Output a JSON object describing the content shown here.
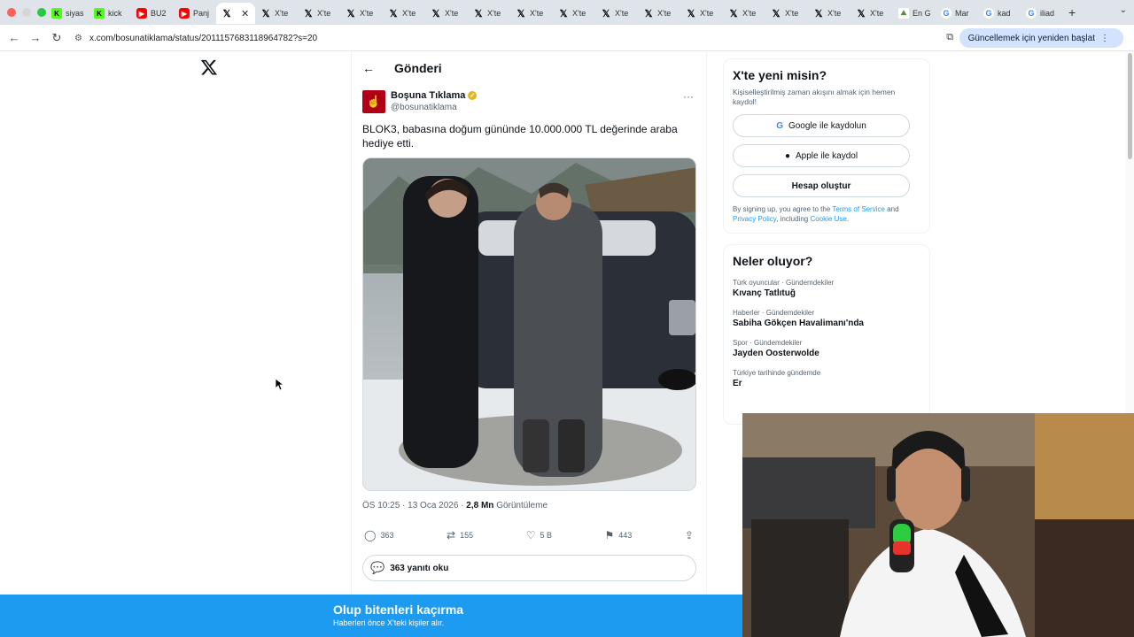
{
  "browser": {
    "tabs": [
      {
        "icon": "kick-icon",
        "label": "siyas"
      },
      {
        "icon": "kick-icon",
        "label": "kick"
      },
      {
        "icon": "youtube-icon",
        "label": "BU2"
      },
      {
        "icon": "youtube-icon",
        "label": "Panj"
      },
      {
        "icon": "x-icon",
        "label": "",
        "active": true
      },
      {
        "icon": "x-icon",
        "label": "X'te"
      },
      {
        "icon": "x-icon",
        "label": "X'te"
      },
      {
        "icon": "x-icon",
        "label": "X'te"
      },
      {
        "icon": "x-icon",
        "label": "X'te"
      },
      {
        "icon": "x-icon",
        "label": "X'te"
      },
      {
        "icon": "x-icon",
        "label": "X'te"
      },
      {
        "icon": "x-icon",
        "label": "X'te"
      },
      {
        "icon": "x-icon",
        "label": "X'te"
      },
      {
        "icon": "x-icon",
        "label": "X'te"
      },
      {
        "icon": "x-icon",
        "label": "X'te"
      },
      {
        "icon": "x-icon",
        "label": "X'te"
      },
      {
        "icon": "x-icon",
        "label": "X'te"
      },
      {
        "icon": "x-icon",
        "label": "X'te"
      },
      {
        "icon": "x-icon",
        "label": "X'te"
      },
      {
        "icon": "x-icon",
        "label": "X'te"
      },
      {
        "icon": "ensonhaber-icon",
        "label": "En G"
      },
      {
        "icon": "google-icon",
        "label": "Mar"
      },
      {
        "icon": "google-icon",
        "label": "kad"
      },
      {
        "icon": "google-icon",
        "label": "iliad"
      }
    ],
    "url": "x.com/bosunatiklama/status/2011157683118964782?s=20",
    "update_label": "Güncellemek için yeniden başlat"
  },
  "post": {
    "header_title": "Gönderi",
    "author_name": "Boşuna Tıklama",
    "author_handle": "@bosunatiklama",
    "text": "BLOK3, babasına doğum gününde 10.000.000 TL değerinde araba hediye etti.",
    "time": "ÖS 10:25 · 13 Oca 2026 · ",
    "views_count": "2,8 Mn",
    "views_label": " Görüntüleme",
    "replies": "363",
    "reposts": "155",
    "likes": "5 B",
    "bookmarks": "443",
    "read_replies": "363 yanıtı oku"
  },
  "signup": {
    "title": "X'te yeni misin?",
    "desc": "Kişiselleştirilmiş zaman akışını almak için hemen kaydol!",
    "google": "Google ile kaydolun",
    "apple": "Apple ile kaydol",
    "create": "Hesap oluştur",
    "legal_pre": "By signing up, you agree to the ",
    "terms": "Terms of Service",
    "and": " and ",
    "privacy": "Privacy Policy",
    "including": ", including ",
    "cookie": "Cookie Use",
    "end": "."
  },
  "trends": {
    "title": "Neler oluyor?",
    "items": [
      {
        "context": "Türk oyuncular · Gündemdekiler",
        "name": "Kıvanç Tatlıtuğ"
      },
      {
        "context": "Haberler · Gündemdekiler",
        "name": "Sabiha Gökçen Havalimanı'nda"
      },
      {
        "context": "Spor · Gündemdekiler",
        "name": "Jayden Oosterwolde"
      },
      {
        "context": "Türkiye tarihinde gündemde",
        "name": "Er"
      }
    ]
  },
  "banner": {
    "title": "Olup bitenleri kaçırma",
    "subtitle": "Haberleri önce X'teki kişiler alır."
  }
}
